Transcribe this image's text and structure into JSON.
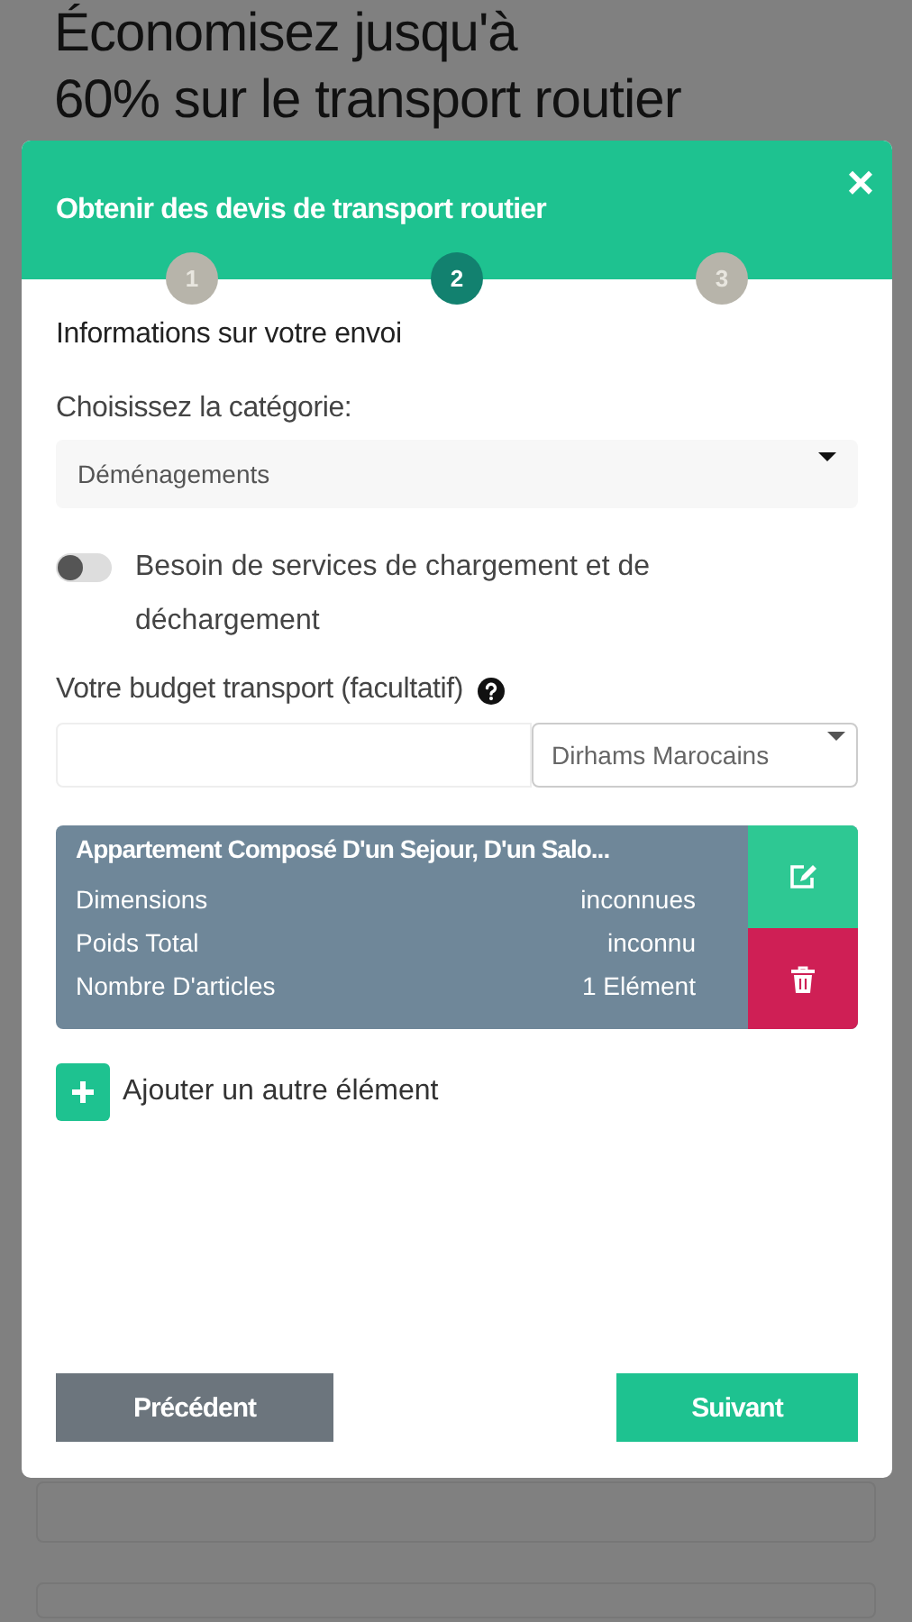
{
  "page": {
    "headline_lines": [
      "Économisez jusqu'à",
      "60% sur le transport routier"
    ]
  },
  "modal": {
    "title": "Obtenir des devis de transport routier",
    "close": "×",
    "steps": [
      {
        "label": "1",
        "selected": false
      },
      {
        "label": "2",
        "selected": true
      },
      {
        "label": "3",
        "selected": false
      }
    ],
    "section_title": "Informations sur votre envoi",
    "category": {
      "label": "Choisissez la catégorie:",
      "value": "Déménagements"
    },
    "loading_toggle": {
      "label": "Besoin de services de chargement et de déchargement",
      "on": false
    },
    "budget": {
      "label": "Votre budget transport (facultatif)",
      "currency": "Dirhams Marocains"
    },
    "items": [
      {
        "title": "Appartement Composé D'un Sejour, D'un Salo...",
        "rows": [
          {
            "name": "Dimensions",
            "value": "inconnues"
          },
          {
            "name": "Poids Total",
            "value": "inconnu"
          },
          {
            "name": "Nombre D'articles",
            "value": "1 Elément"
          }
        ]
      }
    ],
    "add_item": "Ajouter un autre élément",
    "buttons": [
      {
        "label": "Précédent",
        "kind": "secondary"
      },
      {
        "label": "Suivant",
        "kind": "primary"
      }
    ]
  }
}
